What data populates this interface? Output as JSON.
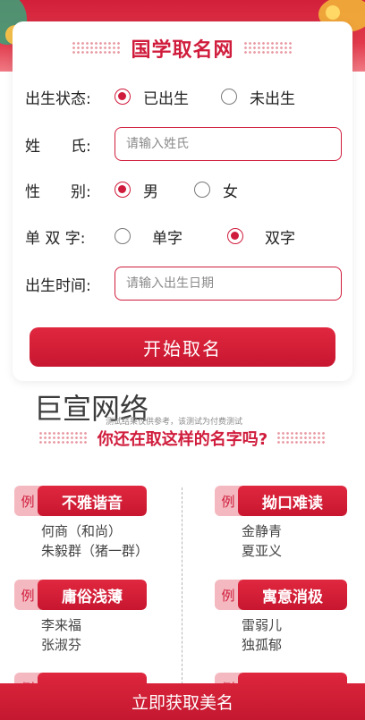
{
  "colors": {
    "brand_red": "#d01c3c",
    "tag_light": "#f4b9c0"
  },
  "banner": {
    "icons": [
      "cloud-decoration-icon",
      "dragon-decoration-icon"
    ]
  },
  "form": {
    "title": "国学取名网",
    "status": {
      "label": "出生状态:",
      "options": [
        {
          "label": "已出生",
          "selected": true
        },
        {
          "label": "未出生",
          "selected": false
        }
      ]
    },
    "surname": {
      "label": "姓　　氏:",
      "placeholder": "请输入姓氏",
      "value": ""
    },
    "gender": {
      "label": "性　　别:",
      "options": [
        {
          "label": "男",
          "selected": true
        },
        {
          "label": "女",
          "selected": false
        }
      ]
    },
    "char_count": {
      "label": "单 双 字:",
      "options": [
        {
          "label": "单字",
          "selected": false
        },
        {
          "label": "双字",
          "selected": true
        }
      ]
    },
    "birth_time": {
      "label": "出生时间:",
      "placeholder": "请输入出生日期",
      "value": ""
    },
    "submit_label": "开始取名"
  },
  "watermark": "巨宣网络",
  "notice": "测试结果仅供参考，该测试为付费测试",
  "examples": {
    "title": "你还在取这样的名字吗?",
    "prefix": "例",
    "groups": [
      {
        "name": "不雅谐音",
        "names": [
          "何商（和尚）",
          "朱毅群（猪一群）"
        ]
      },
      {
        "name": "拗口难读",
        "names": [
          "金静青",
          "夏亚义"
        ]
      },
      {
        "name": "庸俗浅薄",
        "names": [
          "李来福",
          "张淑芬"
        ]
      },
      {
        "name": "寓意消极",
        "names": [
          "雷弱儿",
          "独孤郁"
        ]
      }
    ]
  },
  "bottom_button": "立即获取美名"
}
